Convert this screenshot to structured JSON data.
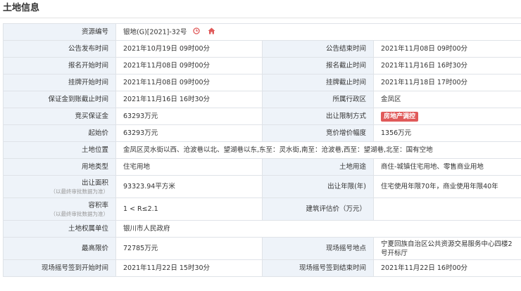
{
  "page": {
    "title": "土地信息"
  },
  "rows": {
    "r1": {
      "label": "资源编号",
      "value": "银地(G)[2021]-32号"
    },
    "r2": {
      "label1": "公告发布时间",
      "value1": "2021年10月19日 09时00分",
      "label2": "公告结束时间",
      "value2": "2021年11月08日 09时00分"
    },
    "r3": {
      "label1": "报名开始时间",
      "value1": "2021年11月08日 09时00分",
      "label2": "报名截止时间",
      "value2": "2021年11月16日 16时30分"
    },
    "r4": {
      "label1": "挂牌开始时间",
      "value1": "2021年11月08日 09时00分",
      "label2": "挂牌截止时间",
      "value2": "2021年11月18日 17时00分"
    },
    "r5": {
      "label1": "保证金到账截止时间",
      "value1": "2021年11月16日 16时30分",
      "label2": "所属行政区",
      "value2": "金凤区"
    },
    "r6": {
      "label1": "竞买保证金",
      "value1": "63293万元",
      "label2": "出让限制方式",
      "badge": "房地产调控"
    },
    "r7": {
      "label1": "起始价",
      "value1": "63293万元",
      "label2": "竞价增价幅度",
      "value2": "1356万元"
    },
    "r8": {
      "label": "土地位置",
      "value": "金凤区灵水街以西、沧波巷以北、望湖巷以东,东至：灵水街,南至：沧波巷,西至：望湖巷,北至：国有空地"
    },
    "r9": {
      "label1": "用地类型",
      "value1": "住宅用地",
      "label2": "土地用途",
      "value2": "商住-城镇住宅用地、零售商业用地"
    },
    "r10": {
      "label1": "出让面积",
      "note1": "（以最终审批数据为准）",
      "value1": "93323.94平方米",
      "label2": "出让年限(年)",
      "value2": "住宅使用年限70年，商业使用年限40年"
    },
    "r11": {
      "label1": "容积率",
      "note1": "（以最终审批数据为准）",
      "value1": "1 < R≤2.1",
      "label2": "建筑评估价（万元）",
      "value2": ""
    },
    "r12": {
      "label": "土地权属单位",
      "value": "银川市人民政府"
    },
    "r13": {
      "label1": "最高限价",
      "value1": "72785万元",
      "label2": "现场摇号地点",
      "value2": "宁夏回族自治区公共资源交易服务中心四楼2号开标厅"
    },
    "r14": {
      "label1": "现场摇号签到开始时间",
      "value1": "2021年11月22日 15时30分",
      "label2": "现场摇号签到结束时间",
      "value2": "2021年11月22日 16时00分"
    }
  },
  "icons": {
    "clock": "clock-icon",
    "home": "home-icon",
    "accent": "#e05a5a"
  }
}
